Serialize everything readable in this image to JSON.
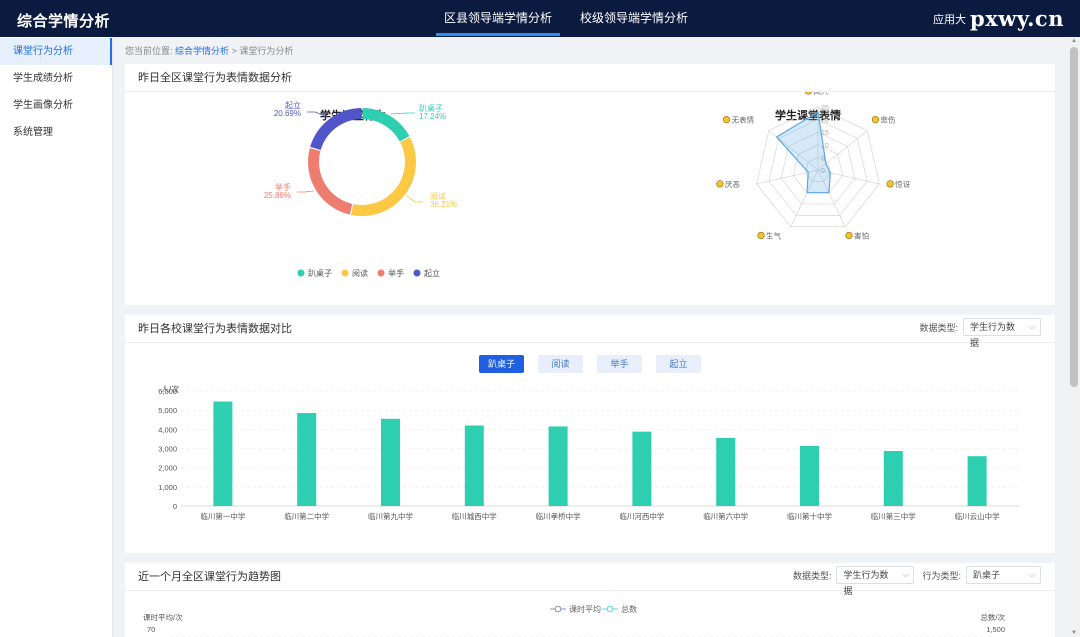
{
  "header": {
    "brand": "综合学情分析",
    "nav": [
      {
        "label": "区县领导端学情分析",
        "active": true
      },
      {
        "label": "校级领导端学情分析",
        "active": false
      }
    ],
    "app_center": "应用大",
    "watermark": "pxwy.cn"
  },
  "sidebar": {
    "items": [
      {
        "label": "课堂行为分析",
        "active": true
      },
      {
        "label": "学生成绩分析",
        "active": false
      },
      {
        "label": "学生画像分析",
        "active": false
      },
      {
        "label": "系统管理",
        "active": false
      }
    ]
  },
  "breadcrumb": {
    "prefix": "您当前位置:",
    "link": "综合学情分析",
    "sep": ">",
    "current": "课堂行为分析"
  },
  "section1": {
    "title": "昨日全区课堂行为表情数据分析",
    "donut_title": "学生课堂行为",
    "radar_title": "学生课堂表情"
  },
  "section2": {
    "title": "昨日各校课堂行为表情数据对比",
    "data_type_label": "数据类型:",
    "data_type_value": "学生行为数据",
    "tabs": [
      "趴桌子",
      "阅读",
      "举手",
      "起立"
    ],
    "active_tab": 0
  },
  "section3": {
    "title": "近一个月全区课堂行为趋势图",
    "data_type_label": "数据类型:",
    "data_type_value": "学生行为数据",
    "behavior_label": "行为类型:",
    "behavior_value": "趴桌子"
  },
  "chart_data": [
    {
      "type": "pie",
      "title": "学生课堂行为",
      "slices": [
        {
          "name": "趴桌子",
          "value": 17.24,
          "label": "17.24%",
          "color": "#2ecfb1"
        },
        {
          "name": "阅读",
          "value": 36.21,
          "label": "36.21%",
          "color": "#fdc843"
        },
        {
          "name": "举手",
          "value": 25.86,
          "label": "25.86%",
          "color": "#ef7d6f"
        },
        {
          "name": "起立",
          "value": 20.69,
          "label": "20.69%",
          "color": "#5056c9"
        }
      ],
      "legend_position": "bottom"
    },
    {
      "type": "radar",
      "title": "学生课堂表情",
      "indicators": [
        "高兴",
        "悲伤",
        "惊讶",
        "害怕",
        "生气",
        "厌恶",
        "无表情"
      ],
      "values": [
        23,
        4,
        5,
        10,
        10,
        4,
        21
      ],
      "max": 25,
      "ticks": [
        "0",
        "5",
        "10",
        "15",
        "20",
        "25"
      ],
      "color": "#5aa6e6"
    },
    {
      "type": "bar",
      "ylabel": "人/次",
      "categories": [
        "临川第一中学",
        "临川第二中学",
        "临川第九中学",
        "临川城西中学",
        "临川孝桥中学",
        "临川河西中学",
        "临川第六中学",
        "临川第十中学",
        "临川第三中学",
        "临川云山中学"
      ],
      "values": [
        5450,
        4850,
        4550,
        4200,
        4150,
        3880,
        3550,
        3130,
        2870,
        2600
      ],
      "ylim": [
        0,
        6000
      ],
      "yticks": [
        "0",
        "1,000",
        "2,000",
        "3,000",
        "4,000",
        "5,000",
        "6,000"
      ],
      "color": "#2ecfb1",
      "grid": true
    },
    {
      "type": "line",
      "legend": [
        "课时平均",
        "总数"
      ],
      "ylabel_left": "课时平均/次",
      "ylabel_right": "总数/次",
      "left_top_tick": "70",
      "right_top_tick": "1,500",
      "colors": [
        "#8a94b8",
        "#5fd4d0"
      ]
    }
  ]
}
